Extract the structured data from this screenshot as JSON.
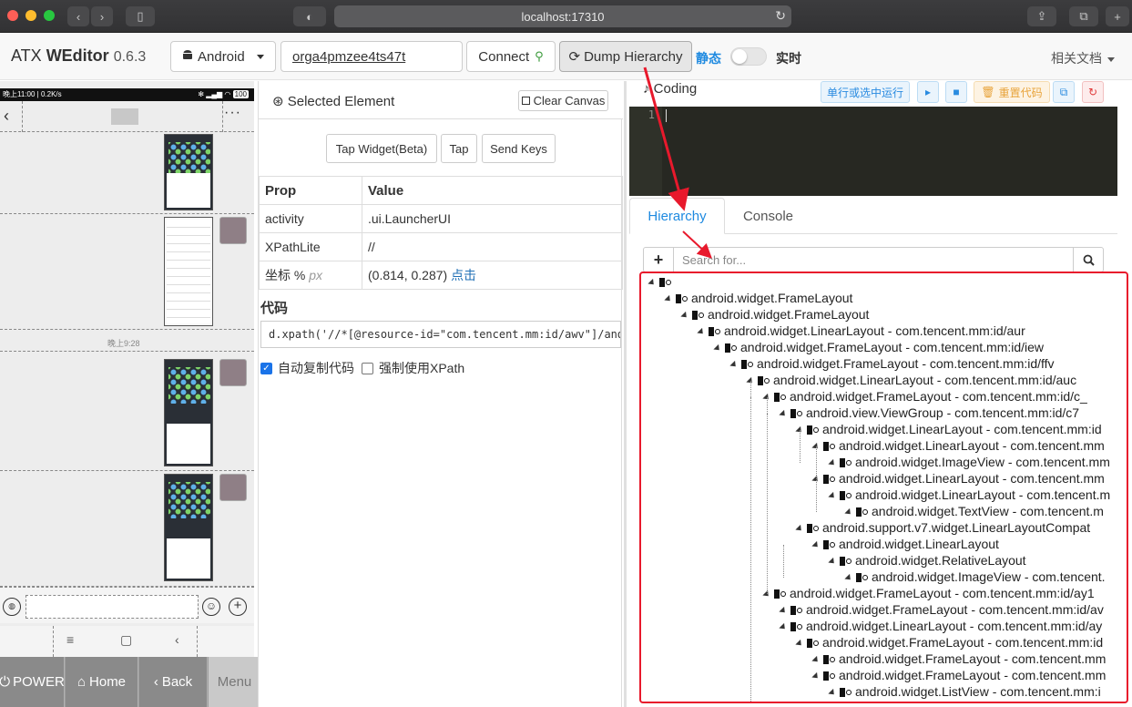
{
  "browser": {
    "url": "localhost:17310"
  },
  "navbar": {
    "brand_prefix": "ATX",
    "brand_name": "WEditor",
    "version": "0.6.3",
    "platform": "Android",
    "serial": "orga4pmzee4ts47t",
    "connect_label": "Connect",
    "dump_label": "Dump Hierarchy",
    "static_label": "静态",
    "realtime_label": "实时",
    "docs_label": "相关文档"
  },
  "phone": {
    "status_left": "晚上11:00 | 0.2K/s",
    "status_right": "100",
    "time_label": "晚上9:28"
  },
  "device_buttons": {
    "power": "POWER",
    "home": "Home",
    "back": "Back",
    "menu": "Menu"
  },
  "selected": {
    "title": "Selected Element",
    "clear_label": "Clear Canvas",
    "tap_widget_label": "Tap Widget(Beta)",
    "tap_label": "Tap",
    "send_keys_label": "Send Keys",
    "col_prop": "Prop",
    "col_value": "Value",
    "rows": [
      {
        "prop": "activity",
        "value": ".ui.LauncherUI"
      },
      {
        "prop": "XPathLite",
        "value": "//"
      }
    ],
    "coord_prop": "坐标 %",
    "coord_unit": "px",
    "coord_value": "(0.814, 0.287)",
    "coord_link": "点击",
    "code_label": "代码",
    "code": "d.xpath('//*[@resource-id=\"com.tencent.mm:id/awv\"]/android.widget",
    "auto_copy_label": "自动复制代码",
    "force_xpath_label": "强制使用XPath"
  },
  "coding": {
    "title": "Coding",
    "run_label": "单行或选中运行",
    "reset_label": "重置代码",
    "line_number": "1"
  },
  "tabs": {
    "hierarchy": "Hierarchy",
    "console": "Console"
  },
  "search": {
    "placeholder": "Search for..."
  },
  "tree": [
    "",
    "android.widget.FrameLayout",
    "android.widget.FrameLayout",
    "android.widget.LinearLayout - com.tencent.mm:id/aur",
    "android.widget.FrameLayout - com.tencent.mm:id/iew",
    "android.widget.FrameLayout - com.tencent.mm:id/ffv",
    "android.widget.LinearLayout - com.tencent.mm:id/auc",
    "android.widget.FrameLayout - com.tencent.mm:id/c_",
    "android.view.ViewGroup - com.tencent.mm:id/c7",
    "android.widget.LinearLayout - com.tencent.mm:id",
    "android.widget.LinearLayout - com.tencent.mm",
    "android.widget.ImageView - com.tencent.mm",
    "android.widget.LinearLayout - com.tencent.mm",
    "android.widget.LinearLayout - com.tencent.m",
    "android.widget.TextView - com.tencent.m",
    "android.support.v7.widget.LinearLayoutCompat",
    "android.widget.LinearLayout",
    "android.widget.RelativeLayout",
    "android.widget.ImageView - com.tencent.",
    "android.widget.FrameLayout - com.tencent.mm:id/ay1",
    "android.widget.FrameLayout - com.tencent.mm:id/av",
    "android.widget.LinearLayout - com.tencent.mm:id/ay",
    "android.widget.FrameLayout - com.tencent.mm:id",
    "android.widget.FrameLayout - com.tencent.mm",
    "android.widget.FrameLayout - com.tencent.mm",
    "android.widget.ListView - com.tencent.mm:i"
  ],
  "colors": {
    "accent": "#1f8ae0",
    "annotation": "#e8192c"
  }
}
